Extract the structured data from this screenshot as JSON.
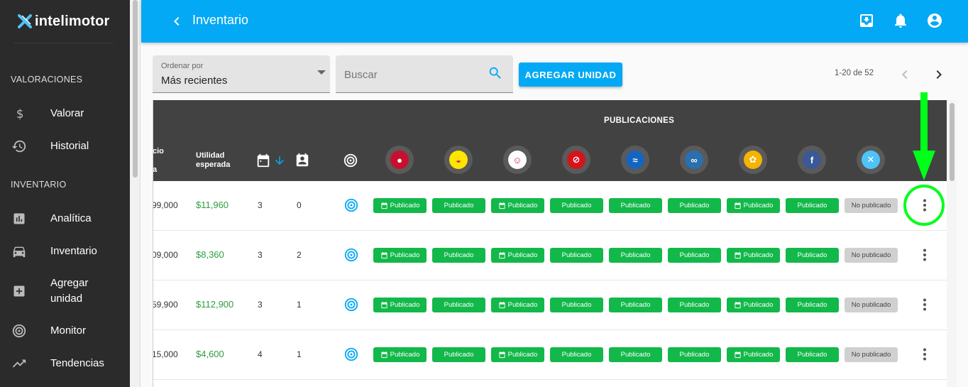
{
  "app": {
    "brand": "intelimotor"
  },
  "sidebar": {
    "sections": [
      {
        "title": "VALORACIONES"
      },
      {
        "title": "INVENTARIO"
      }
    ],
    "items": [
      {
        "label": "Valorar",
        "icon": "dollar-icon"
      },
      {
        "label": "Historial",
        "icon": "history-icon"
      },
      {
        "label": "Analítica",
        "icon": "analytics-icon"
      },
      {
        "label": "Inventario",
        "icon": "car-icon"
      },
      {
        "label": "Agregar unidad",
        "icon": "add-box-icon"
      },
      {
        "label": "Monitor",
        "icon": "monitor-icon"
      },
      {
        "label": "Tendencias",
        "icon": "trending-up-icon"
      }
    ]
  },
  "header": {
    "title": "Inventario",
    "icons": [
      "back-icon",
      "download-icon",
      "bell-icon",
      "account-icon"
    ]
  },
  "toolbar": {
    "sort_label": "Ordenar por",
    "sort_value": "Más recientes",
    "search_placeholder": "Buscar",
    "add_button": "AGREGAR UNIDAD",
    "pagination": "1-20 de 52"
  },
  "table": {
    "publications_title": "PUBLICACIONES",
    "col_price_partial_top": "cio",
    "col_price_partial_bottom": "a",
    "col_utilidad": "Utilidad esperada",
    "platforms": [
      {
        "name": "platform-1",
        "color": "#c8102e",
        "glyph": "●"
      },
      {
        "name": "platform-2",
        "color": "#ffe600",
        "glyph": "◒"
      },
      {
        "name": "platform-3",
        "color": "#ffffff",
        "glyph": "☺"
      },
      {
        "name": "platform-4",
        "color": "#d4141b",
        "glyph": "⊘"
      },
      {
        "name": "platform-5",
        "color": "#1565c0",
        "glyph": "≈"
      },
      {
        "name": "platform-6",
        "color": "#2a6fb0",
        "glyph": "∞"
      },
      {
        "name": "platform-7",
        "color": "#f4b400",
        "glyph": "✿"
      },
      {
        "name": "facebook",
        "color": "#3b5998",
        "glyph": "f"
      },
      {
        "name": "intelimotor",
        "color": "#4fc3f7",
        "glyph": "✕"
      }
    ],
    "rows": [
      {
        "price": "99,000",
        "utilidad": "$11,960",
        "days": "3",
        "contacts": "0",
        "status": [
          "Publicado",
          "Publicado",
          "Publicado",
          "Publicado",
          "Publicado",
          "Publicado",
          "Publicado",
          "Publicado",
          "No publicado"
        ],
        "calendar": [
          true,
          false,
          true,
          false,
          false,
          false,
          true,
          false,
          false
        ]
      },
      {
        "price": "09,000",
        "utilidad": "$8,360",
        "days": "3",
        "contacts": "2",
        "status": [
          "Publicado",
          "Publicado",
          "Publicado",
          "Publicado",
          "Publicado",
          "Publicado",
          "Publicado",
          "Publicado",
          "No publicado"
        ],
        "calendar": [
          true,
          false,
          true,
          false,
          false,
          false,
          true,
          false,
          false
        ]
      },
      {
        "price": "59,900",
        "utilidad": "$112,900",
        "days": "3",
        "contacts": "1",
        "status": [
          "Publicado",
          "Publicado",
          "Publicado",
          "Publicado",
          "Publicado",
          "Publicado",
          "Publicado",
          "Publicado",
          "No publicado"
        ],
        "calendar": [
          true,
          false,
          true,
          false,
          false,
          false,
          true,
          false,
          false
        ]
      },
      {
        "price": "15,000",
        "utilidad": "$4,600",
        "days": "4",
        "contacts": "1",
        "status": [
          "Publicado",
          "Publicado",
          "Publicado",
          "Publicado",
          "Publicado",
          "Publicado",
          "Publicado",
          "Publicado",
          "No publicado"
        ],
        "calendar": [
          true,
          false,
          true,
          false,
          false,
          false,
          true,
          false,
          false
        ]
      }
    ]
  },
  "annotation": {
    "color": "#00ff19"
  }
}
